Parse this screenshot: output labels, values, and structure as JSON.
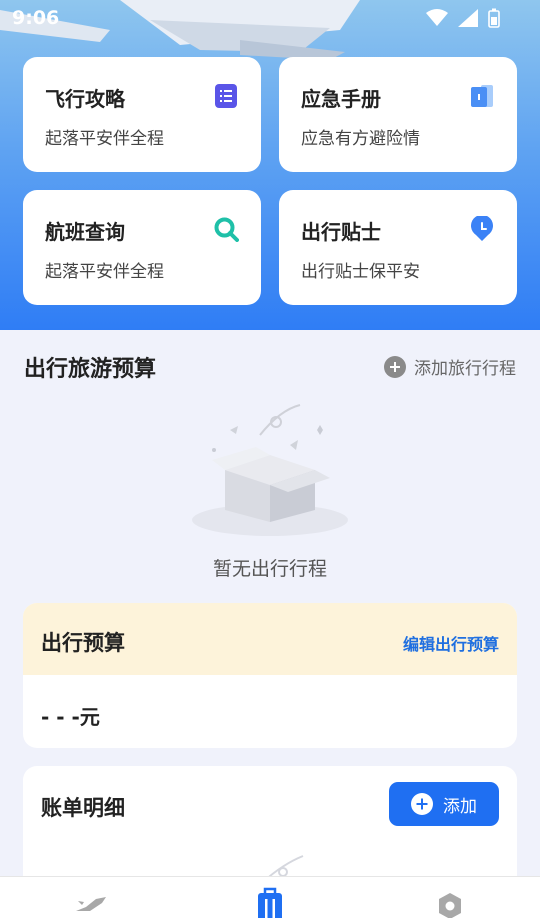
{
  "status_bar": {
    "time": "9:06"
  },
  "cards": [
    {
      "title": "飞行攻略",
      "subtitle": "起落平安伴全程",
      "icon": "document-list-icon",
      "color": "#5a55e8"
    },
    {
      "title": "应急手册",
      "subtitle": "应急有方避险情",
      "icon": "book-icon",
      "color": "#4a8ff5"
    },
    {
      "title": "航班查询",
      "subtitle": "起落平安伴全程",
      "icon": "search-icon",
      "color": "#1fc0a8"
    },
    {
      "title": "出行贴士",
      "subtitle": "出行贴士保平安",
      "icon": "clock-pin-icon",
      "color": "#3b82f6"
    }
  ],
  "trip_section": {
    "title": "出行旅游预算",
    "add_label": "添加旅行行程",
    "empty_text": "暂无出行行程"
  },
  "budget": {
    "title": "出行预算",
    "edit_label": "编辑出行预算",
    "value": "- - -元"
  },
  "bill": {
    "title": "账单明细",
    "add_label": "添加"
  },
  "tabbar": {
    "items": [
      {
        "icon": "airplane-icon",
        "active": false
      },
      {
        "icon": "luggage-icon",
        "active": true
      },
      {
        "icon": "settings-icon",
        "active": false
      }
    ]
  },
  "colors": {
    "accent": "#1f6ff2",
    "budget_header_bg": "#fdf3da"
  }
}
